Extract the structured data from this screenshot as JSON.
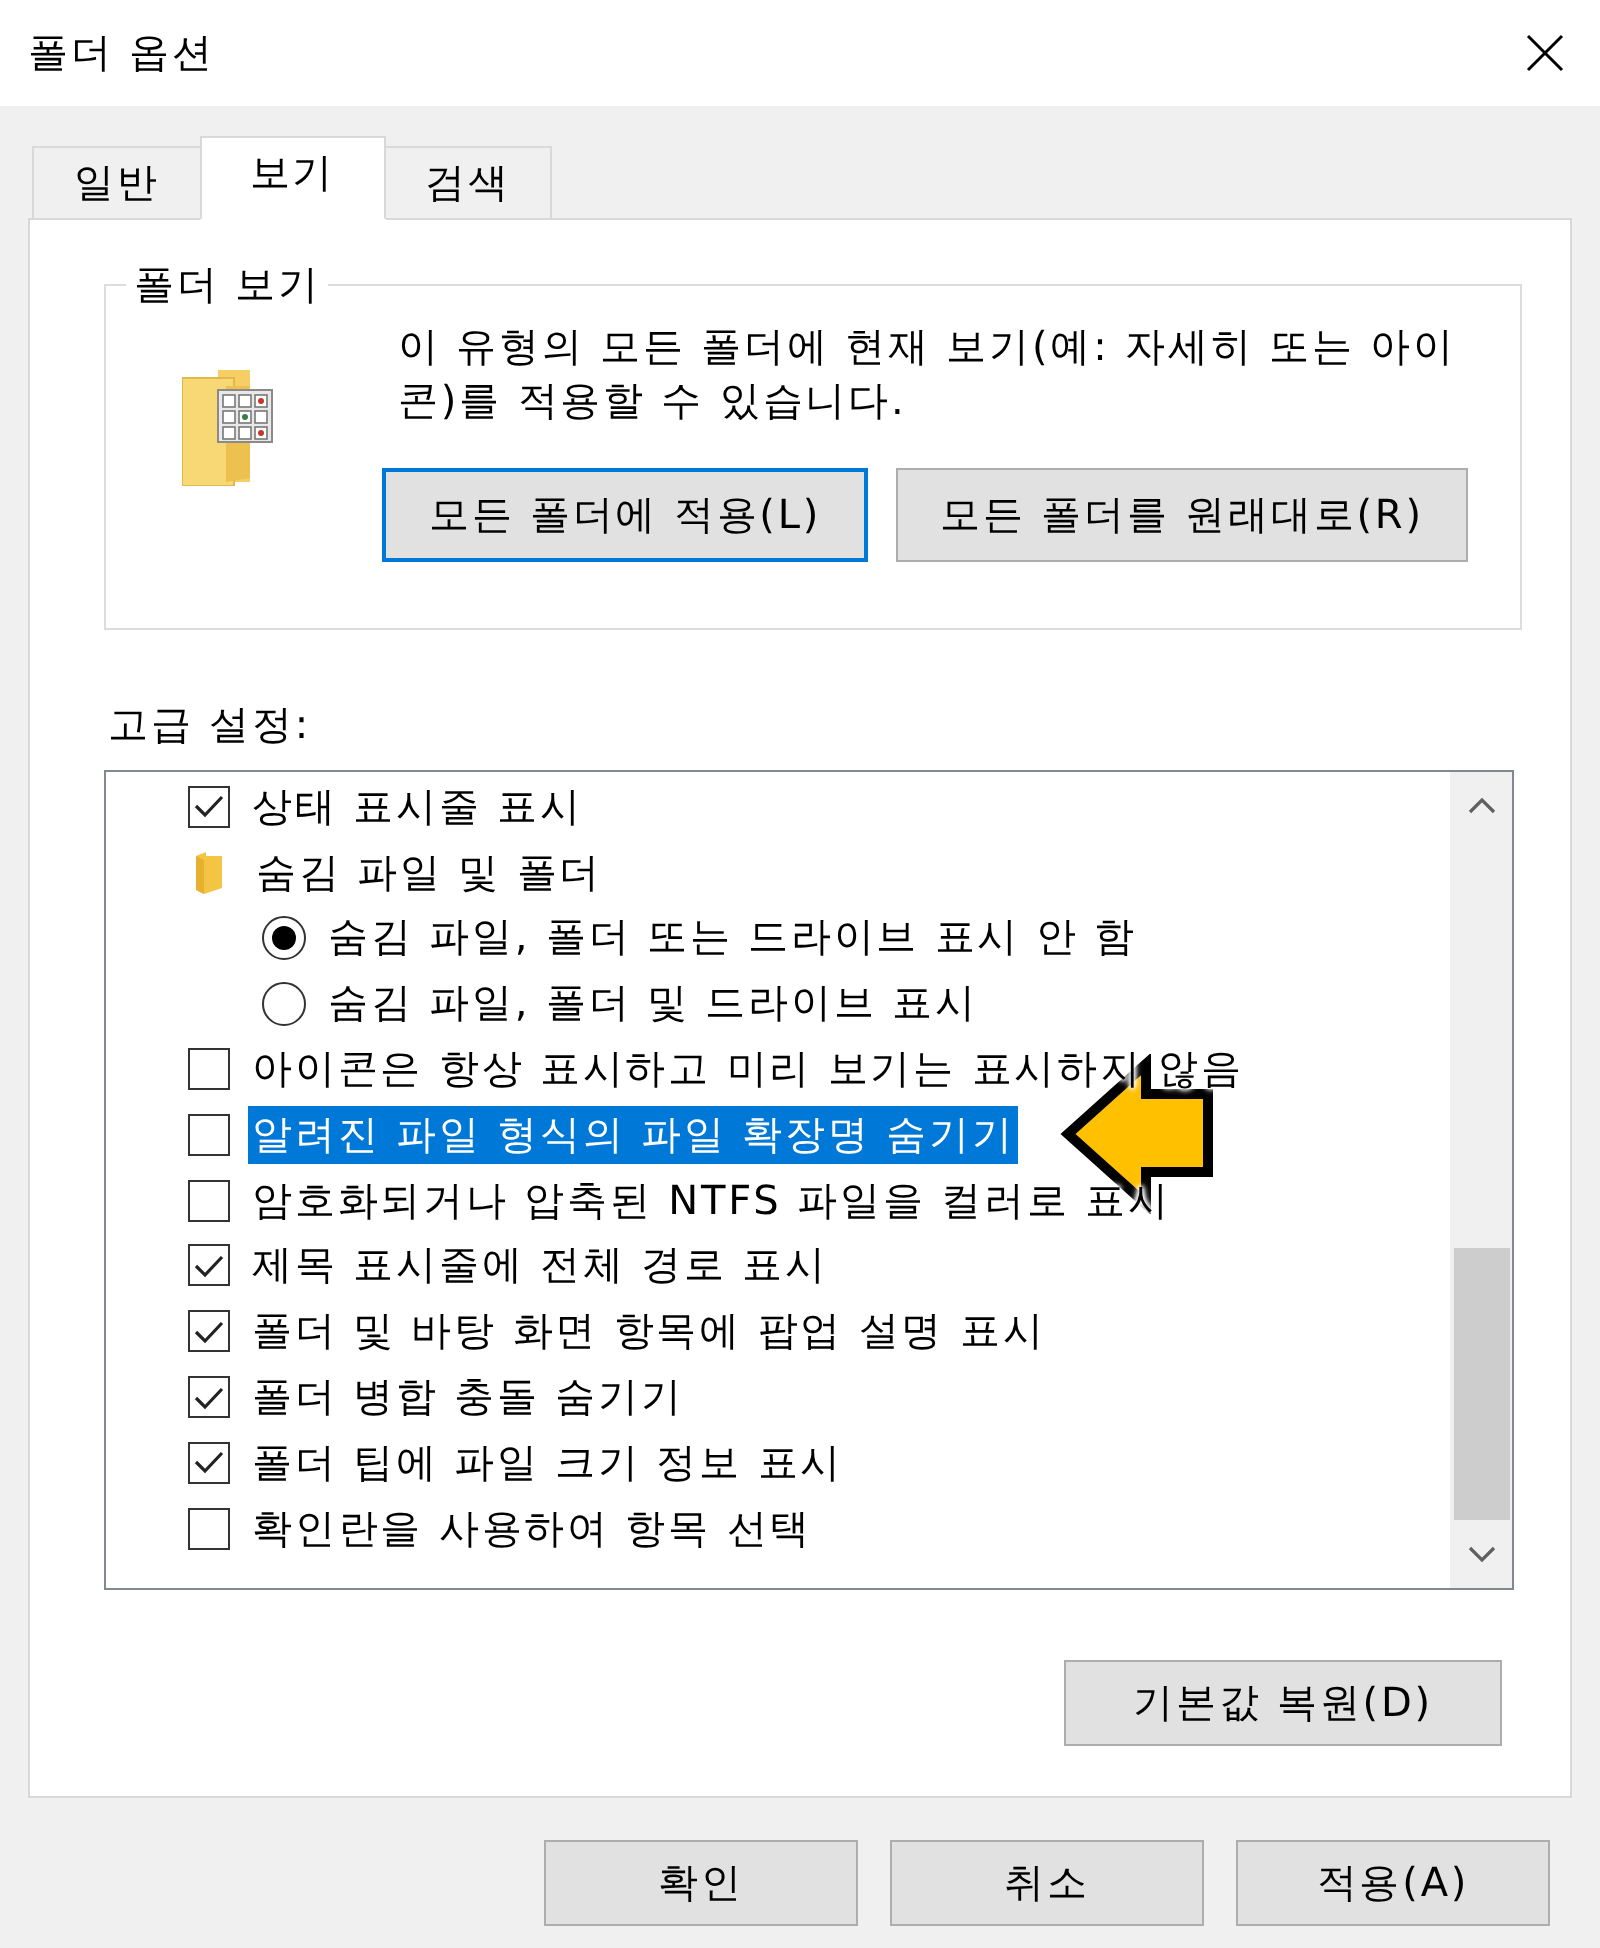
{
  "window": {
    "title": "폴더 옵션"
  },
  "tabs": [
    {
      "label": "일반",
      "selected": false
    },
    {
      "label": "보기",
      "selected": true
    },
    {
      "label": "검색",
      "selected": false
    }
  ],
  "folder_views": {
    "title": "폴더 보기",
    "description": "이 유형의 모든 폴더에 현재 보기(예: 자세히 또는 아이콘)를 적용할 수 있습니다.",
    "buttons": [
      {
        "label": "모든 폴더에 적용(L)",
        "focused": true
      },
      {
        "label": "모든 폴더를 원래대로(R)",
        "focused": false
      }
    ]
  },
  "advanced_settings": {
    "label": "고급 설정:",
    "items": [
      {
        "kind": "checkbox",
        "label": "상태 표시줄 표시",
        "checked": true,
        "selected": false,
        "arrow": false
      },
      {
        "kind": "group",
        "label": "숨김 파일 및 폴더",
        "selected": false,
        "arrow": false,
        "children": [
          {
            "kind": "radio",
            "label": "숨김 파일, 폴더 또는 드라이브 표시 안 함",
            "checked": true,
            "selected": false,
            "arrow": false
          },
          {
            "kind": "radio",
            "label": "숨김 파일, 폴더 및 드라이브 표시",
            "checked": false,
            "selected": false,
            "arrow": false
          }
        ]
      },
      {
        "kind": "checkbox",
        "label": "아이콘은 항상 표시하고 미리 보기는 표시하지 않음",
        "checked": false,
        "selected": false,
        "arrow": false
      },
      {
        "kind": "checkbox",
        "label": "알려진 파일 형식의 파일 확장명 숨기기",
        "checked": false,
        "selected": true,
        "arrow": true
      },
      {
        "kind": "checkbox",
        "label": "암호화되거나 압축된 NTFS 파일을 컬러로 표시",
        "checked": false,
        "selected": false,
        "arrow": false
      },
      {
        "kind": "checkbox",
        "label": "제목 표시줄에 전체 경로 표시",
        "checked": true,
        "selected": false,
        "arrow": false
      },
      {
        "kind": "checkbox",
        "label": "폴더 및 바탕 화면 항목에 팝업 설명 표시",
        "checked": true,
        "selected": false,
        "arrow": false
      },
      {
        "kind": "checkbox",
        "label": "폴더 병합 충돌 숨기기",
        "checked": true,
        "selected": false,
        "arrow": false
      },
      {
        "kind": "checkbox",
        "label": "폴더 팁에 파일 크기 정보 표시",
        "checked": true,
        "selected": false,
        "arrow": false
      },
      {
        "kind": "checkbox",
        "label": "확인란을 사용하여 항목 선택",
        "checked": false,
        "selected": false,
        "arrow": false
      }
    ],
    "restore_button": "기본값 복원(D)"
  },
  "buttons": [
    "확인",
    "취소",
    "적용(A)"
  ]
}
